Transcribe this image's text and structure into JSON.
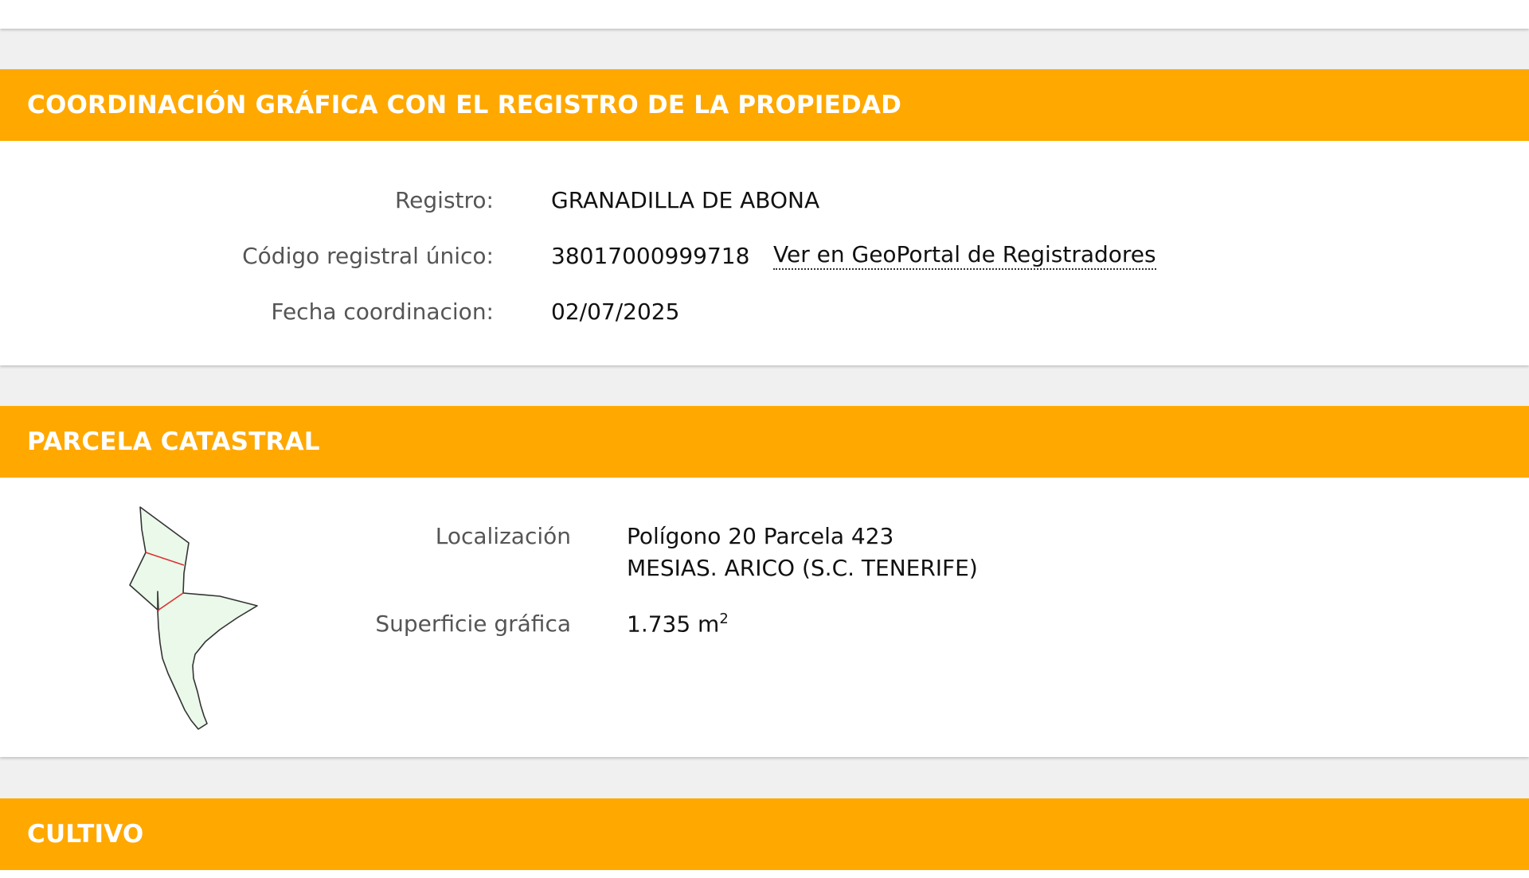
{
  "sections": {
    "coordinacion": {
      "title": "COORDINACIÓN GRÁFICA CON EL REGISTRO DE LA PROPIEDAD",
      "registro_label": "Registro:",
      "registro_value": "GRANADILLA DE ABONA",
      "codigo_label": "Código registral único:",
      "codigo_value": "38017000999718",
      "geoportal_link": "Ver en GeoPortal de Registradores",
      "fecha_label": "Fecha coordinacion:",
      "fecha_value": "02/07/2025"
    },
    "parcela": {
      "title": "PARCELA CATASTRAL",
      "localizacion_label": "Localización",
      "localizacion_line1": "Polígono 20 Parcela 423",
      "localizacion_line2": "MESIAS. ARICO (S.C. TENERIFE)",
      "superficie_label": "Superficie gráfica",
      "superficie_value": "1.735 m",
      "superficie_unit_exp": "2",
      "map": {
        "fill_color": "#eaf9ea",
        "outline_color": "#333333",
        "subdivision_color": "#e03030"
      }
    },
    "cultivo": {
      "title": "CULTIVO"
    }
  },
  "colors": {
    "header_bg": "#ffa800",
    "header_text": "#ffffff",
    "page_bg": "#f0f0f0"
  }
}
